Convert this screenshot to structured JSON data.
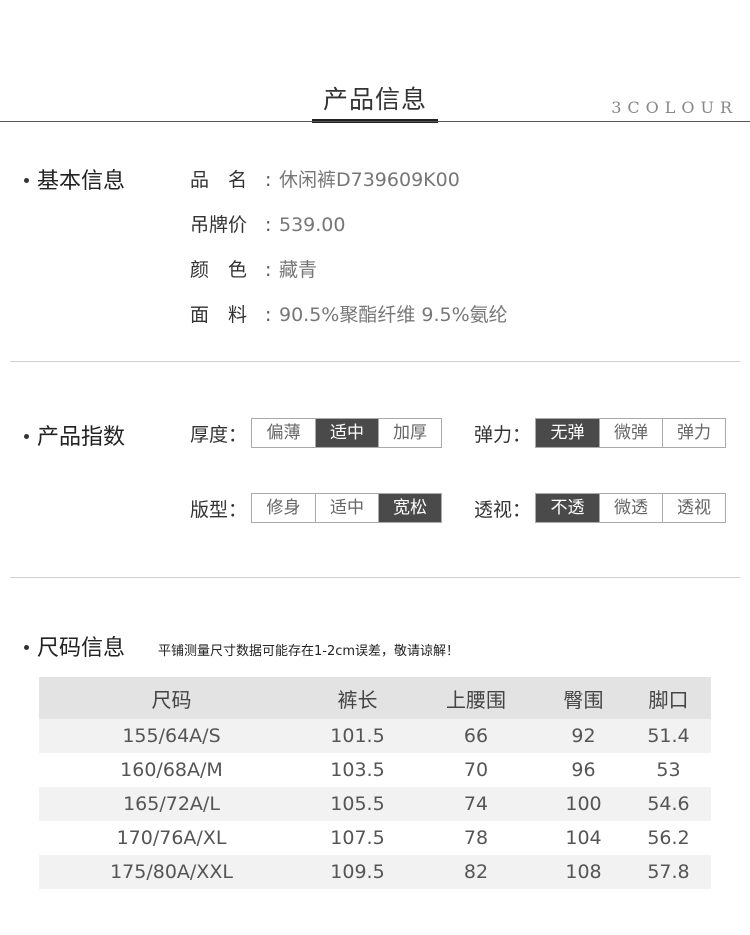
{
  "header": {
    "title": "产品信息",
    "brand": "3COLOUR"
  },
  "basic": {
    "title": "基本信息",
    "rows": [
      {
        "label": "品　名",
        "value": "休闲裤D739609K00"
      },
      {
        "label": "吊牌价",
        "value": "539.00"
      },
      {
        "label": "颜　色",
        "value": "藏青"
      },
      {
        "label": "面　料",
        "value": "90.5%聚酯纤维 9.5%氨纶"
      }
    ]
  },
  "index": {
    "title": "产品指数",
    "thickness": {
      "label": "厚度：",
      "options": [
        "偏薄",
        "适中",
        "加厚"
      ],
      "selected": "适中"
    },
    "elasticity": {
      "label": "弹力：",
      "options": [
        "无弹",
        "微弹",
        "弹力"
      ],
      "selected": "无弹"
    },
    "fit": {
      "label": "版型：",
      "options": [
        "修身",
        "适中",
        "宽松"
      ],
      "selected": "宽松"
    },
    "transparency": {
      "label": "透视：",
      "options": [
        "不透",
        "微透",
        "透视"
      ],
      "selected": "不透"
    }
  },
  "size": {
    "title": "尺码信息",
    "note": "平铺测量尺寸数据可能存在1-2cm误差，敬请谅解！",
    "columns": [
      "尺码",
      "裤长",
      "上腰围",
      "臀围",
      "脚口"
    ],
    "rows": [
      [
        "155/64A/S",
        "101.5",
        "66",
        "92",
        "51.4"
      ],
      [
        "160/68A/M",
        "103.5",
        "70",
        "96",
        "53"
      ],
      [
        "165/72A/L",
        "105.5",
        "74",
        "100",
        "54.6"
      ],
      [
        "170/76A/XL",
        "107.5",
        "78",
        "104",
        "56.2"
      ],
      [
        "175/80A/XXL",
        "109.5",
        "82",
        "108",
        "57.8"
      ]
    ]
  }
}
